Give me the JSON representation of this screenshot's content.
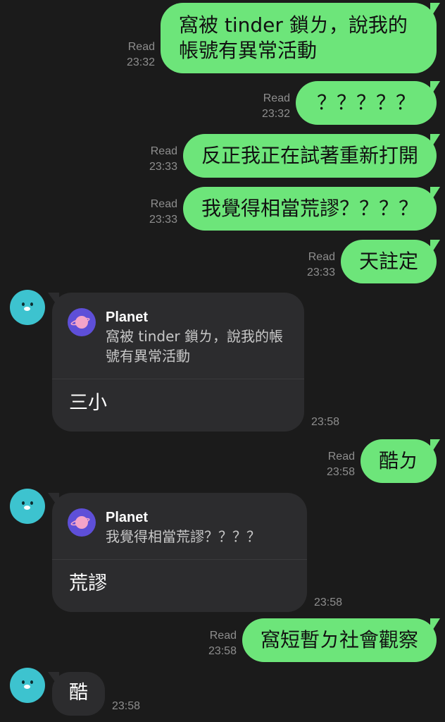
{
  "messages_out": [
    {
      "status": "Read",
      "time": "23:32",
      "text": "窩被 tinder 鎖ㄌ，說我的帳號有異常活動"
    },
    {
      "status": "Read",
      "time": "23:32",
      "text": "？？？？？"
    },
    {
      "status": "Read",
      "time": "23:33",
      "text": "反正我正在試著重新打開"
    },
    {
      "status": "Read",
      "time": "23:33",
      "text": "我覺得相當荒謬？？？？"
    },
    {
      "status": "Read",
      "time": "23:33",
      "text": "天註定"
    },
    {
      "status": "Read",
      "time": "23:58",
      "text": "酷ㄉ"
    },
    {
      "status": "Read",
      "time": "23:58",
      "text": "窩短暫ㄉ社會觀察"
    }
  ],
  "messages_in": [
    {
      "reply_name": "Planet",
      "reply_text": "窩被 tinder 鎖ㄌ，說我的帳號有異常活動",
      "text": "三小",
      "time": "23:58"
    },
    {
      "reply_name": "Planet",
      "reply_text": "我覺得相當荒謬？？？？",
      "text": "荒謬",
      "time": "23:58"
    },
    {
      "text": "酷",
      "time": "23:58"
    }
  ],
  "colors": {
    "background": "#1b1b1b",
    "outgoing_bubble": "#6de57a",
    "incoming_bubble": "#2c2c2e",
    "avatar": "#3dc3cf",
    "planet_icon": "#5e4fd8"
  },
  "icons": {
    "avatar": "bear-avatar-icon",
    "reply_source": "planet-icon"
  }
}
